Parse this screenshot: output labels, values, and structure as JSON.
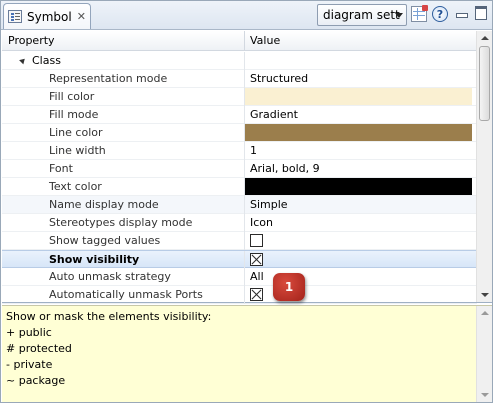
{
  "header": {
    "tab_title": "Symbol",
    "tab_close": "✕",
    "dropdown_value": "diagram sett",
    "help_glyph": "?"
  },
  "table": {
    "col_property": "Property",
    "col_value": "Value",
    "group_label": "Class",
    "rows": [
      {
        "name": "Representation mode",
        "value": "Structured"
      },
      {
        "name": "Fill color",
        "value": "",
        "color": "#faf0d2"
      },
      {
        "name": "Fill mode",
        "value": "Gradient"
      },
      {
        "name": "Line color",
        "value": "",
        "color": "#9b7e4c"
      },
      {
        "name": "Line width",
        "value": "1"
      },
      {
        "name": "Font",
        "value": "Arial, bold, 9"
      },
      {
        "name": "Text color",
        "value": "",
        "color": "#000000"
      },
      {
        "name": "Name display mode",
        "value": "Simple"
      },
      {
        "name": "Stereotypes display mode",
        "value": "Icon"
      },
      {
        "name": "Show tagged values",
        "value": "",
        "checkbox": false
      },
      {
        "name": "Show visibility",
        "value": "",
        "checkbox": true
      },
      {
        "name": "Auto unmask strategy",
        "value": "All"
      },
      {
        "name": "Automatically unmask Ports",
        "value": "",
        "checkbox": true
      }
    ]
  },
  "callout": "1",
  "description": {
    "lines": [
      "Show or mask the elements visibility:",
      "+ public",
      "# protected",
      "-  private",
      "~ package"
    ]
  }
}
